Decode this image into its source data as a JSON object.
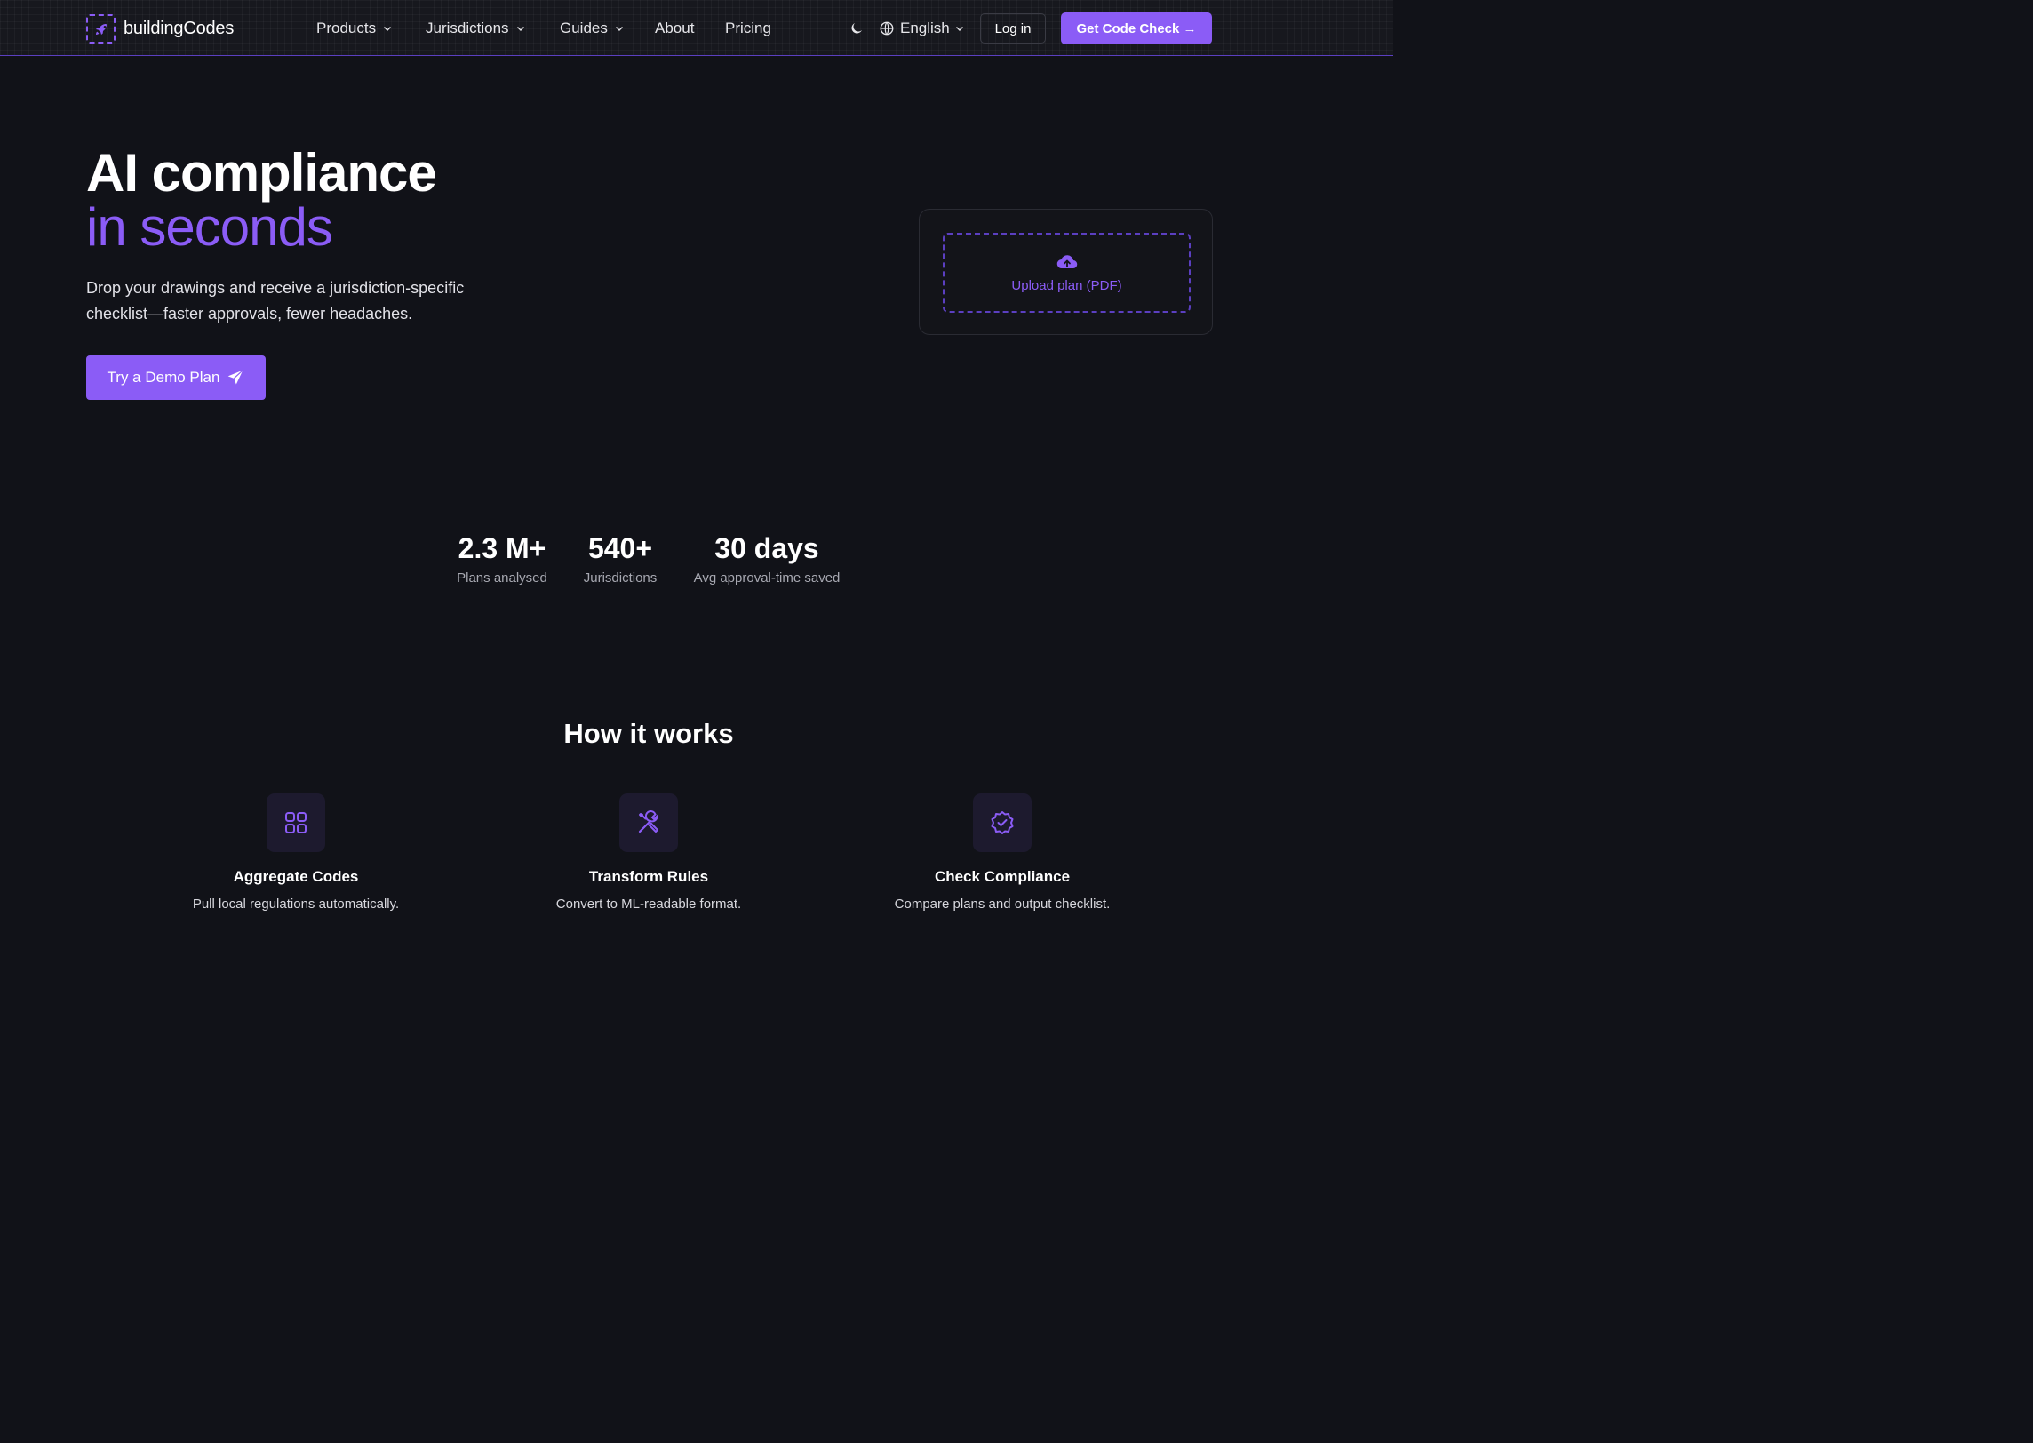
{
  "nav": {
    "brand": "buildingCodes",
    "items": [
      {
        "label": "Products",
        "has_dropdown": true
      },
      {
        "label": "Jurisdictions",
        "has_dropdown": true
      },
      {
        "label": "Guides",
        "has_dropdown": true
      },
      {
        "label": "About",
        "has_dropdown": false
      },
      {
        "label": "Pricing",
        "has_dropdown": false
      }
    ],
    "theme_icon": "moon-icon",
    "language": "English",
    "login_label": "Log in",
    "cta_label": "Get Code Check →"
  },
  "hero": {
    "title_line1": "AI compliance",
    "title_line2": "in seconds",
    "subtitle": "Drop your drawings and receive a jurisdiction-specific checklist—faster approvals, fewer headaches.",
    "demo_label": "Try a Demo Plan",
    "upload_label": "Upload plan (PDF)"
  },
  "stats": [
    {
      "value": "2.3 M+",
      "label": "Plans analysed"
    },
    {
      "value": "540+",
      "label": "Jurisdictions"
    },
    {
      "value": "30 days",
      "label": "Avg approval-time saved"
    }
  ],
  "how_it_works": {
    "title": "How it works",
    "steps": [
      {
        "icon": "grid-icon",
        "title": "Aggregate Codes",
        "desc": "Pull local regulations automatically."
      },
      {
        "icon": "tools-icon",
        "title": "Transform Rules",
        "desc": "Convert to ML-readable format."
      },
      {
        "icon": "badge-check-icon",
        "title": "Check Compliance",
        "desc": "Compare plans and output checklist."
      }
    ]
  },
  "colors": {
    "accent": "#8b5cf6",
    "background": "#111218",
    "nav_bg": "#17181e",
    "icon_bg": "#1d1a2e"
  }
}
